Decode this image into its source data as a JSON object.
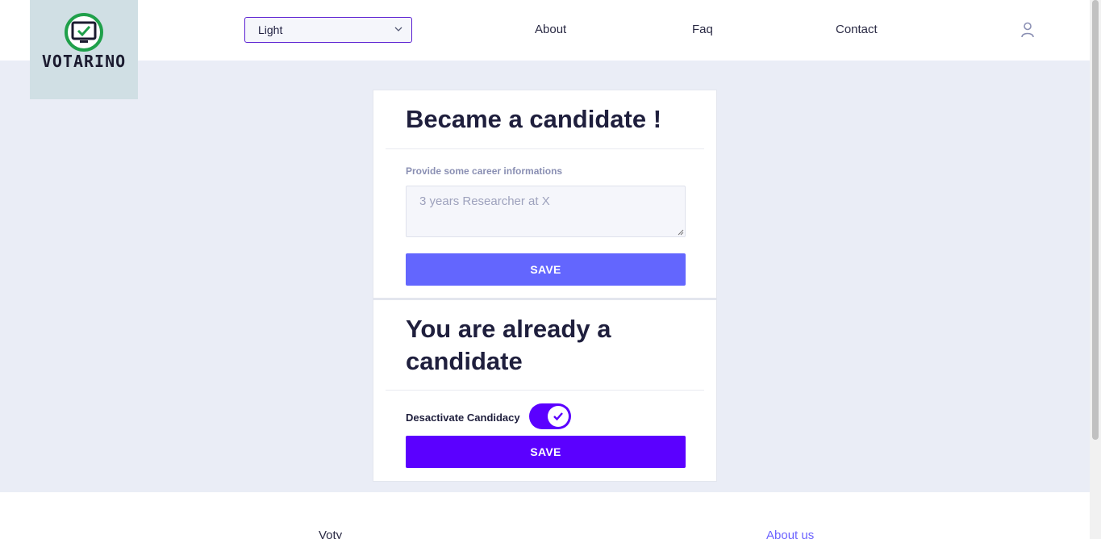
{
  "header": {
    "logo_text": "VOTARINO",
    "theme_select": {
      "value": "Light"
    },
    "nav": {
      "about": "About",
      "faq": "Faq",
      "contact": "Contact"
    }
  },
  "candidate_form": {
    "title": "Became a candidate !",
    "field_label": "Provide some career informations",
    "career_placeholder": "3 years Researcher at X",
    "save_label": "SAVE"
  },
  "candidacy_status": {
    "title": "You are already a candidate",
    "toggle_label": "Desactivate Candidacy",
    "toggle_on": true,
    "save_label": "SAVE"
  },
  "footer": {
    "brand": "Voty",
    "about_link": "About us"
  },
  "colors": {
    "accent": "#5b00ff",
    "primary_button": "#6366fe",
    "page_background": "#eaedf6",
    "logo_background": "#d0dfe4",
    "logo_check": "#1fa04a"
  }
}
